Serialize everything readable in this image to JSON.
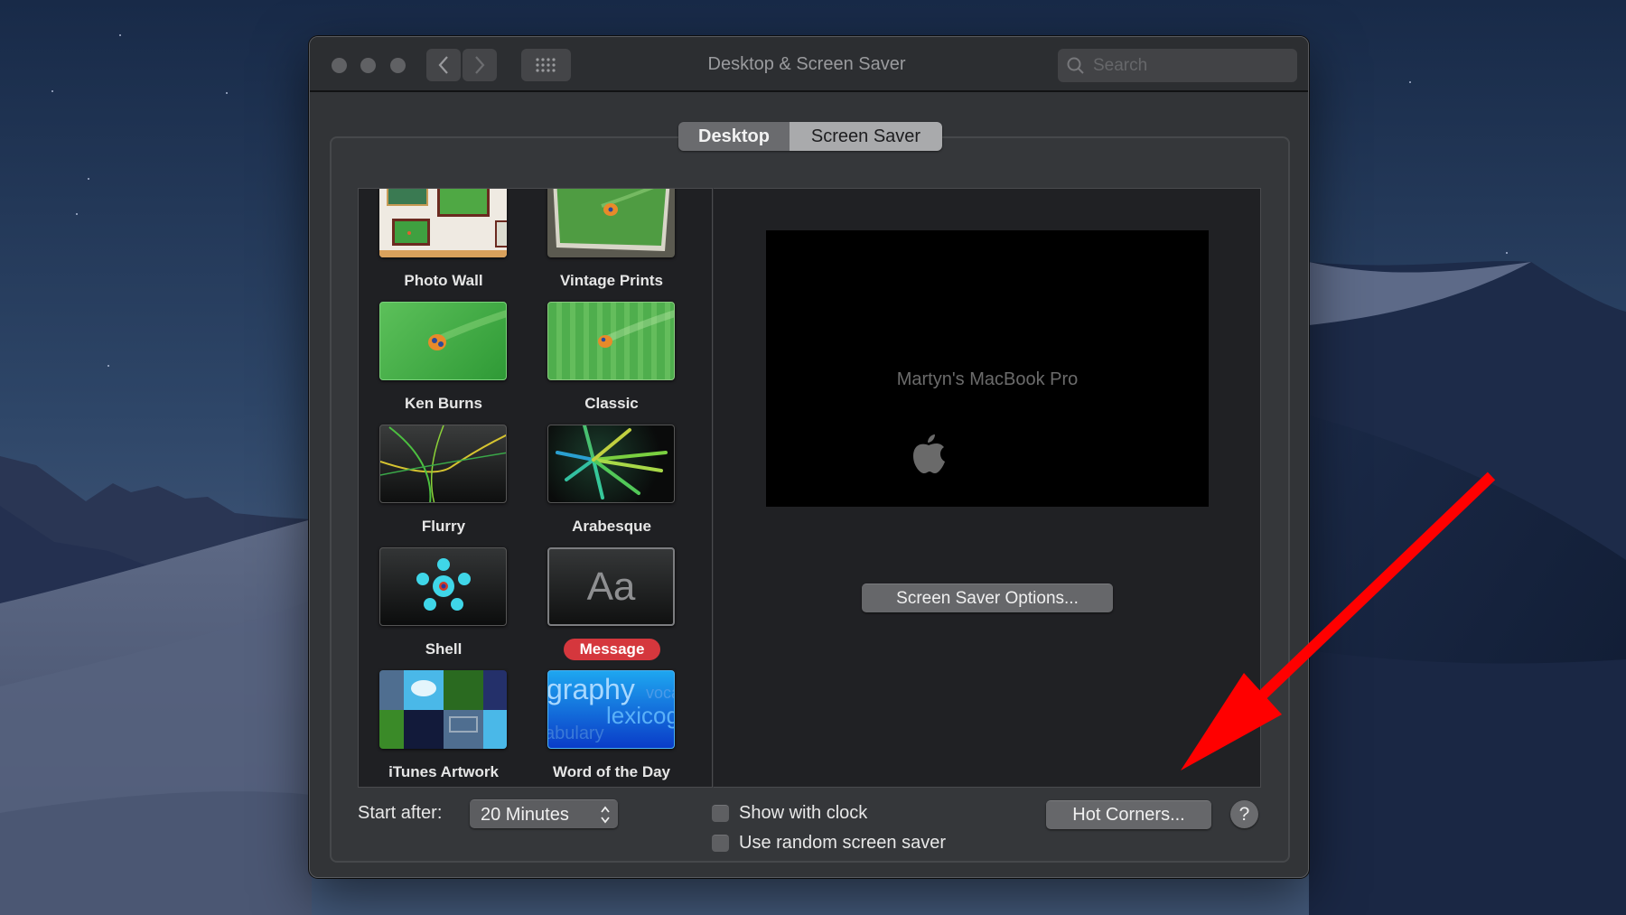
{
  "window": {
    "title": "Desktop & Screen Saver",
    "search_placeholder": "Search",
    "nav": {
      "back_icon": "chevron-left-icon",
      "forward_icon": "chevron-right-icon",
      "grid_icon": "show-all-grid-icon"
    }
  },
  "tabs": [
    {
      "label": "Desktop",
      "selected": false
    },
    {
      "label": "Screen Saver",
      "selected": true
    }
  ],
  "screen_savers": [
    {
      "label": "Photo Wall",
      "thumbnail": "photo-wall",
      "selected": false
    },
    {
      "label": "Vintage Prints",
      "thumbnail": "vintage-prints",
      "selected": false
    },
    {
      "label": "Ken Burns",
      "thumbnail": "ken-burns",
      "selected": false
    },
    {
      "label": "Classic",
      "thumbnail": "classic",
      "selected": false
    },
    {
      "label": "Flurry",
      "thumbnail": "flurry",
      "selected": false
    },
    {
      "label": "Arabesque",
      "thumbnail": "arabesque",
      "selected": false
    },
    {
      "label": "Shell",
      "thumbnail": "shell",
      "selected": false
    },
    {
      "label": "Message",
      "thumbnail": "message",
      "thumbnail_text": "Aa",
      "selected": true
    },
    {
      "label": "iTunes Artwork",
      "thumbnail": "itunes-artwork",
      "selected": false
    },
    {
      "label": "Word of the Day",
      "thumbnail": "word-of-the-day",
      "thumbnail_words": [
        "graphy",
        "voca",
        "lexicog",
        "abulary"
      ],
      "selected": false
    }
  ],
  "preview": {
    "message": "Martyn's MacBook Pro",
    "logo": "apple-logo-icon"
  },
  "buttons": {
    "options": "Screen Saver Options...",
    "hot_corners": "Hot Corners...",
    "help": "?"
  },
  "settings": {
    "start_after_label": "Start after:",
    "start_after_value": "20 Minutes",
    "show_with_clock": {
      "label": "Show with clock",
      "checked": false
    },
    "random_saver": {
      "label": "Use random screen saver",
      "checked": false
    }
  },
  "colors": {
    "selection_badge": "#d5373d",
    "annotation_arrow": "#ff0000"
  }
}
